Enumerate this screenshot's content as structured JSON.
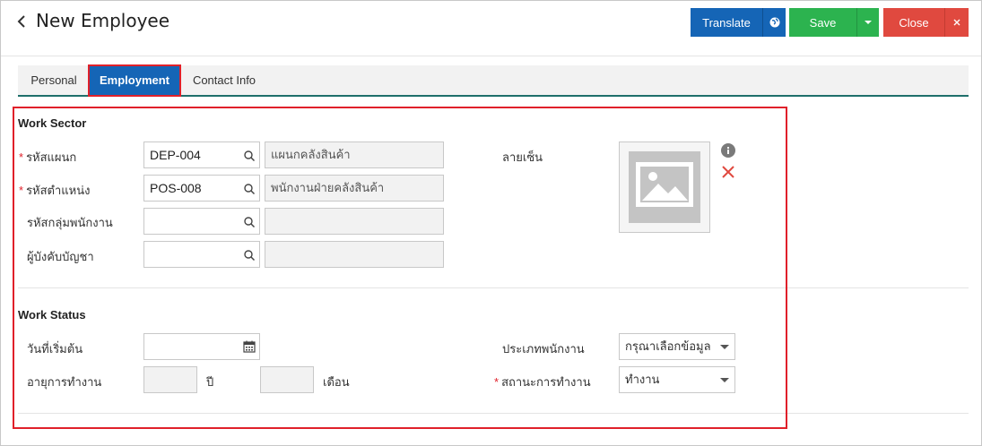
{
  "header": {
    "title": "New Employee",
    "translate_label": "Translate",
    "save_label": "Save",
    "close_label": "Close"
  },
  "tabs": [
    {
      "label": "Personal"
    },
    {
      "label": "Employment"
    },
    {
      "label": "Contact Info"
    }
  ],
  "work_sector": {
    "title": "Work Sector",
    "department_code": {
      "label": "รหัสแผนก",
      "value": "DEP-004",
      "name": "แผนกคลังสินค้า"
    },
    "position_code": {
      "label": "รหัสตำแหน่ง",
      "value": "POS-008",
      "name": "พนักงานฝ่ายคลังสินค้า"
    },
    "employee_group_code": {
      "label": "รหัสกลุ่มพนักงาน",
      "value": "",
      "name": ""
    },
    "supervisor": {
      "label": "ผู้บังคับบัญชา",
      "value": "",
      "name": ""
    },
    "signature_label": "ลายเซ็น"
  },
  "work_status": {
    "title": "Work Status",
    "start_date": {
      "label": "วันที่เริ่มต้น",
      "value": ""
    },
    "employee_type": {
      "label": "ประเภทพนักงาน",
      "selected": "กรุณาเลือกข้อมูล"
    },
    "service_age": {
      "label": "อายุการทำงาน",
      "years_unit": "ปี",
      "months_unit": "เดือน",
      "years": "",
      "months": ""
    },
    "employment_status": {
      "label": "สถานะการทำงาน",
      "selected": "ทำงาน"
    }
  },
  "colors": {
    "primary": "#1565b6",
    "save": "#2cb34f",
    "close": "#e0493f",
    "highlight": "#e0202a",
    "tab_underline": "#1e6f6a"
  }
}
